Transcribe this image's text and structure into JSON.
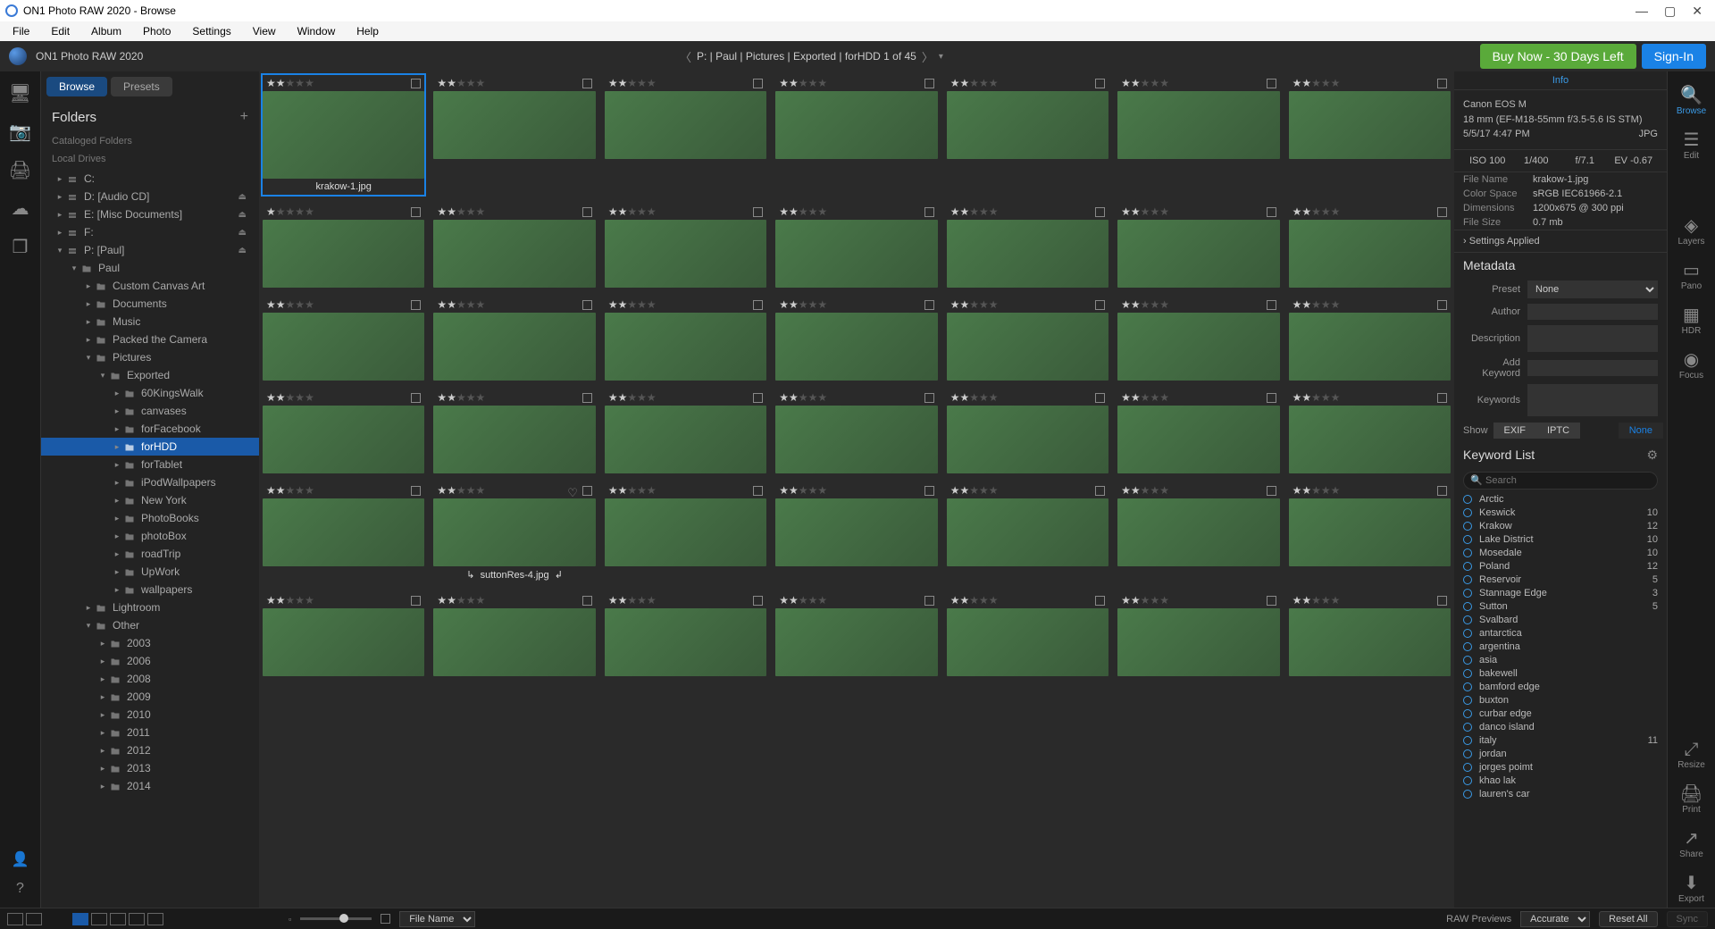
{
  "titlebar": {
    "title": "ON1 Photo RAW 2020 - Browse"
  },
  "menubar": [
    "File",
    "Edit",
    "Album",
    "Photo",
    "Settings",
    "View",
    "Window",
    "Help"
  ],
  "appheader": {
    "title": "ON1 Photo RAW 2020",
    "breadcrumb": "P: | Paul | Pictures | Exported | forHDD   1 of 45",
    "buy": "Buy Now - 30 Days Left",
    "signin": "Sign-In"
  },
  "lefttabs": {
    "browse": "Browse",
    "presets": "Presets"
  },
  "folders": {
    "title": "Folders",
    "cataloged": "Cataloged Folders",
    "localdrives": "Local Drives",
    "drives": [
      {
        "label": "C:",
        "eject": false
      },
      {
        "label": "D: [Audio CD]",
        "eject": true
      },
      {
        "label": "E: [Misc Documents]",
        "eject": true
      },
      {
        "label": "F:",
        "eject": true
      },
      {
        "label": "P: [Paul]",
        "eject": true,
        "expanded": true
      }
    ],
    "paul": "Paul",
    "paul_children": [
      "Custom Canvas Art",
      "Documents",
      "Music",
      "Packed the Camera"
    ],
    "pictures": "Pictures",
    "exported": "Exported",
    "exported_children": [
      "60KingsWalk",
      "canvases",
      "forFacebook",
      "forHDD",
      "forTablet",
      "iPodWallpapers",
      "New York",
      "PhotoBooks",
      "photoBox",
      "roadTrip",
      "UpWork",
      "wallpapers"
    ],
    "other_under_pictures": [
      "Lightroom"
    ],
    "other": "Other",
    "years": [
      "2003",
      "2006",
      "2008",
      "2009",
      "2010",
      "2011",
      "2012",
      "2013",
      "2014"
    ]
  },
  "grid": {
    "selected_caption": "krakow-1.jpg",
    "hover_caption": "suttonRes-4.jpg",
    "rows": [
      [
        {
          "r": 2,
          "t": "t-city",
          "sel": true
        },
        {
          "r": 2,
          "t": "t-city"
        },
        {
          "r": 2,
          "t": "t-arch"
        },
        {
          "r": 2,
          "t": "t-arch"
        },
        {
          "r": 2,
          "t": "t-green"
        },
        {
          "r": 2,
          "t": "t-bw"
        },
        {
          "r": 2,
          "t": "t-bw"
        }
      ],
      [
        {
          "r": 1,
          "t": "t-bw"
        },
        {
          "r": 2,
          "t": "t-bw"
        },
        {
          "r": 2,
          "t": "t-bw"
        },
        {
          "r": 2,
          "t": "t-bw"
        },
        {
          "r": 2,
          "t": "t-arch"
        },
        {
          "r": 2,
          "t": "t-city"
        },
        {
          "r": 2,
          "t": "t-green"
        }
      ],
      [
        {
          "r": 2,
          "t": "t-green"
        },
        {
          "r": 2,
          "t": "t-green"
        },
        {
          "r": 2,
          "t": "t-green"
        },
        {
          "r": 2,
          "t": "t-water"
        },
        {
          "r": 2,
          "t": "t-water"
        },
        {
          "r": 2,
          "t": "t-green"
        },
        {
          "r": 2,
          "t": "t-green"
        }
      ],
      [
        {
          "r": 2,
          "t": "t-green"
        },
        {
          "r": 2,
          "t": "t-green"
        },
        {
          "r": 2,
          "t": "t-rock"
        },
        {
          "r": 2,
          "t": "t-rock"
        },
        {
          "r": 2,
          "t": "t-rock"
        },
        {
          "r": 2,
          "t": "t-green"
        },
        {
          "r": 2,
          "t": "t-green"
        }
      ],
      [
        {
          "r": 2,
          "t": "t-green"
        },
        {
          "r": 2,
          "t": "t-green",
          "heart": true,
          "hover": true
        },
        {
          "r": 2,
          "t": "t-green"
        },
        {
          "r": 2,
          "t": "t-canal"
        },
        {
          "r": 2,
          "t": "t-canal"
        },
        {
          "r": 2,
          "t": "t-canal"
        },
        {
          "r": 2,
          "t": "t-canal"
        }
      ],
      [
        {
          "r": 2,
          "t": "t-canal"
        },
        {
          "r": 2,
          "t": "t-canal"
        },
        {
          "r": 2,
          "t": "t-canal"
        },
        {
          "r": 2,
          "t": "t-canal"
        },
        {
          "r": 2,
          "t": "t-canal"
        },
        {
          "r": 2,
          "t": "t-canal"
        },
        {
          "r": 2,
          "t": "t-water"
        }
      ]
    ]
  },
  "info": {
    "tab": "Info",
    "camera": "Canon EOS M",
    "lens": "18 mm (EF-M18-55mm f/3.5-5.6 IS STM)",
    "date": "5/5/17 4:47 PM",
    "format": "JPG",
    "iso": "ISO 100",
    "shutter": "1/400",
    "aperture": "f/7.1",
    "ev": "EV -0.67",
    "file_name_k": "File Name",
    "file_name_v": "krakow-1.jpg",
    "color_space_k": "Color Space",
    "color_space_v": "sRGB IEC61966-2.1",
    "dimensions_k": "Dimensions",
    "dimensions_v": "1200x675 @ 300 ppi",
    "file_size_k": "File Size",
    "file_size_v": "0.7 mb",
    "settings_applied": "Settings Applied"
  },
  "metadata": {
    "title": "Metadata",
    "preset_lbl": "Preset",
    "preset_val": "None",
    "author_lbl": "Author",
    "desc_lbl": "Description",
    "addkw_lbl": "Add Keyword",
    "keywords_lbl": "Keywords",
    "show": "Show",
    "exif": "EXIF",
    "iptc": "IPTC",
    "none": "None"
  },
  "keywords": {
    "title": "Keyword List",
    "search_ph": "Search",
    "items": [
      {
        "name": "Arctic"
      },
      {
        "name": "Keswick",
        "count": "10"
      },
      {
        "name": "Krakow",
        "count": "12"
      },
      {
        "name": "Lake District",
        "count": "10"
      },
      {
        "name": "Mosedale",
        "count": "10"
      },
      {
        "name": "Poland",
        "count": "12"
      },
      {
        "name": "Reservoir",
        "count": "5"
      },
      {
        "name": "Stannage Edge",
        "count": "3"
      },
      {
        "name": "Sutton",
        "count": "5"
      },
      {
        "name": "Svalbard"
      },
      {
        "name": "antarctica"
      },
      {
        "name": "argentina"
      },
      {
        "name": "asia"
      },
      {
        "name": "bakewell"
      },
      {
        "name": "bamford edge"
      },
      {
        "name": "buxton"
      },
      {
        "name": "curbar edge"
      },
      {
        "name": "danco island"
      },
      {
        "name": "italy",
        "count": "11"
      },
      {
        "name": "jordan"
      },
      {
        "name": "jorges poimt"
      },
      {
        "name": "khao lak"
      },
      {
        "name": "lauren's car"
      }
    ]
  },
  "rightrail": {
    "browse": "Browse",
    "edit": "Edit",
    "layers": "Layers",
    "pano": "Pano",
    "hdr": "HDR",
    "focus": "Focus",
    "resize": "Resize",
    "print": "Print",
    "share": "Share",
    "export": "Export"
  },
  "bottombar": {
    "sortby": "File Name",
    "raw": "RAW Previews",
    "accurate": "Accurate",
    "reset": "Reset All",
    "sync": "Sync"
  }
}
